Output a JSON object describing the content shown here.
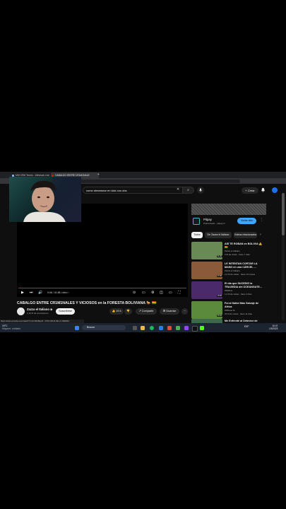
{
  "browser": {
    "tabs": [
      {
        "label": "MSI CRM Tecnio - Windows Live",
        "color": "#8ab4f8"
      },
      {
        "label": "CABALGO ENTRE CR1M1NALE",
        "color": "#ff0000"
      }
    ],
    "new_tab_icon": "+"
  },
  "header": {
    "search_value": "como streamear en kick con obs",
    "clear_icon": "✕",
    "search_icon": "⌕",
    "mic_icon": "🎤",
    "create_label": "+ Crear",
    "bell_icon": "🔔"
  },
  "player": {
    "time": "0:06 / 41:58 • intro ›",
    "progress": 0.01
  },
  "video": {
    "title": "CABALGO ENTRE CR1M1NALES Y VICIOSOS en la FORESTA BOLIVIANA 🐎 🇧🇴",
    "channel_name": "Zazza el Italiano ⊗",
    "subscribers": "2,19 M de suscriptores",
    "subscribe_label": "Suscribirse",
    "likes": "👍 19 k",
    "dislike_icon": "👎",
    "share_label": "↗ Compartir",
    "save_label": "⊞ Guardar",
    "more_icon": "⋯"
  },
  "status_url": "https://www.youtube.com/watch?v=vCJWo8spc8 · RITA CRUZ DE LA SIERRA",
  "ad": {
    "title": "Pitpay",
    "sponsor": "Patrocinado · pitpay.cl",
    "button": "Visitar sitio"
  },
  "chips": [
    "Todos",
    "De Zazza el Italiano",
    "Videos relacionados"
  ],
  "recommendations": [
    {
      "title": "ASÍ TE ROBAN en BOLIVIA ⚠️ 🇧🇴",
      "channel": "Zazza el Italiano",
      "meta": "2 M de vistas · hace 7 días",
      "duration": "31:49",
      "color": "#6a8a55"
    },
    {
      "title": "LE INTENTAN CORTAR LA MANO en una CÁRCEL ...",
      "channel": "Zazza el Italiano",
      "meta": "2,4 M de vistas · hace 10 meses",
      "duration": "37:08",
      "color": "#8a5a3a"
    },
    {
      "title": "El día que SUCEDIÓ la TRAGEDIA del OCEANGATE...",
      "channel": "Wikiflow",
      "meta": "1,2 M de vistas · hace 2 días",
      "duration": "18:08",
      "color": "#4a2a6a"
    },
    {
      "title": "Fui al Safari Mas Salvaje de Africa",
      "channel": "MrBeast ⊗",
      "meta": "31 M de vistas · hace 11 días",
      "duration": "20:43",
      "color": "#5a8a3a"
    },
    {
      "title": "Me Enfrenté al Detector de",
      "channel": "",
      "meta": "",
      "duration": "",
      "color": "#3a6a4a"
    }
  ],
  "taskbar": {
    "weather_temp": "19°C",
    "weather_desc": "Mayorm. nublado",
    "search_placeholder": "Buscar",
    "tray": "ESP",
    "time": "10:47",
    "date": "1/3/2023"
  }
}
